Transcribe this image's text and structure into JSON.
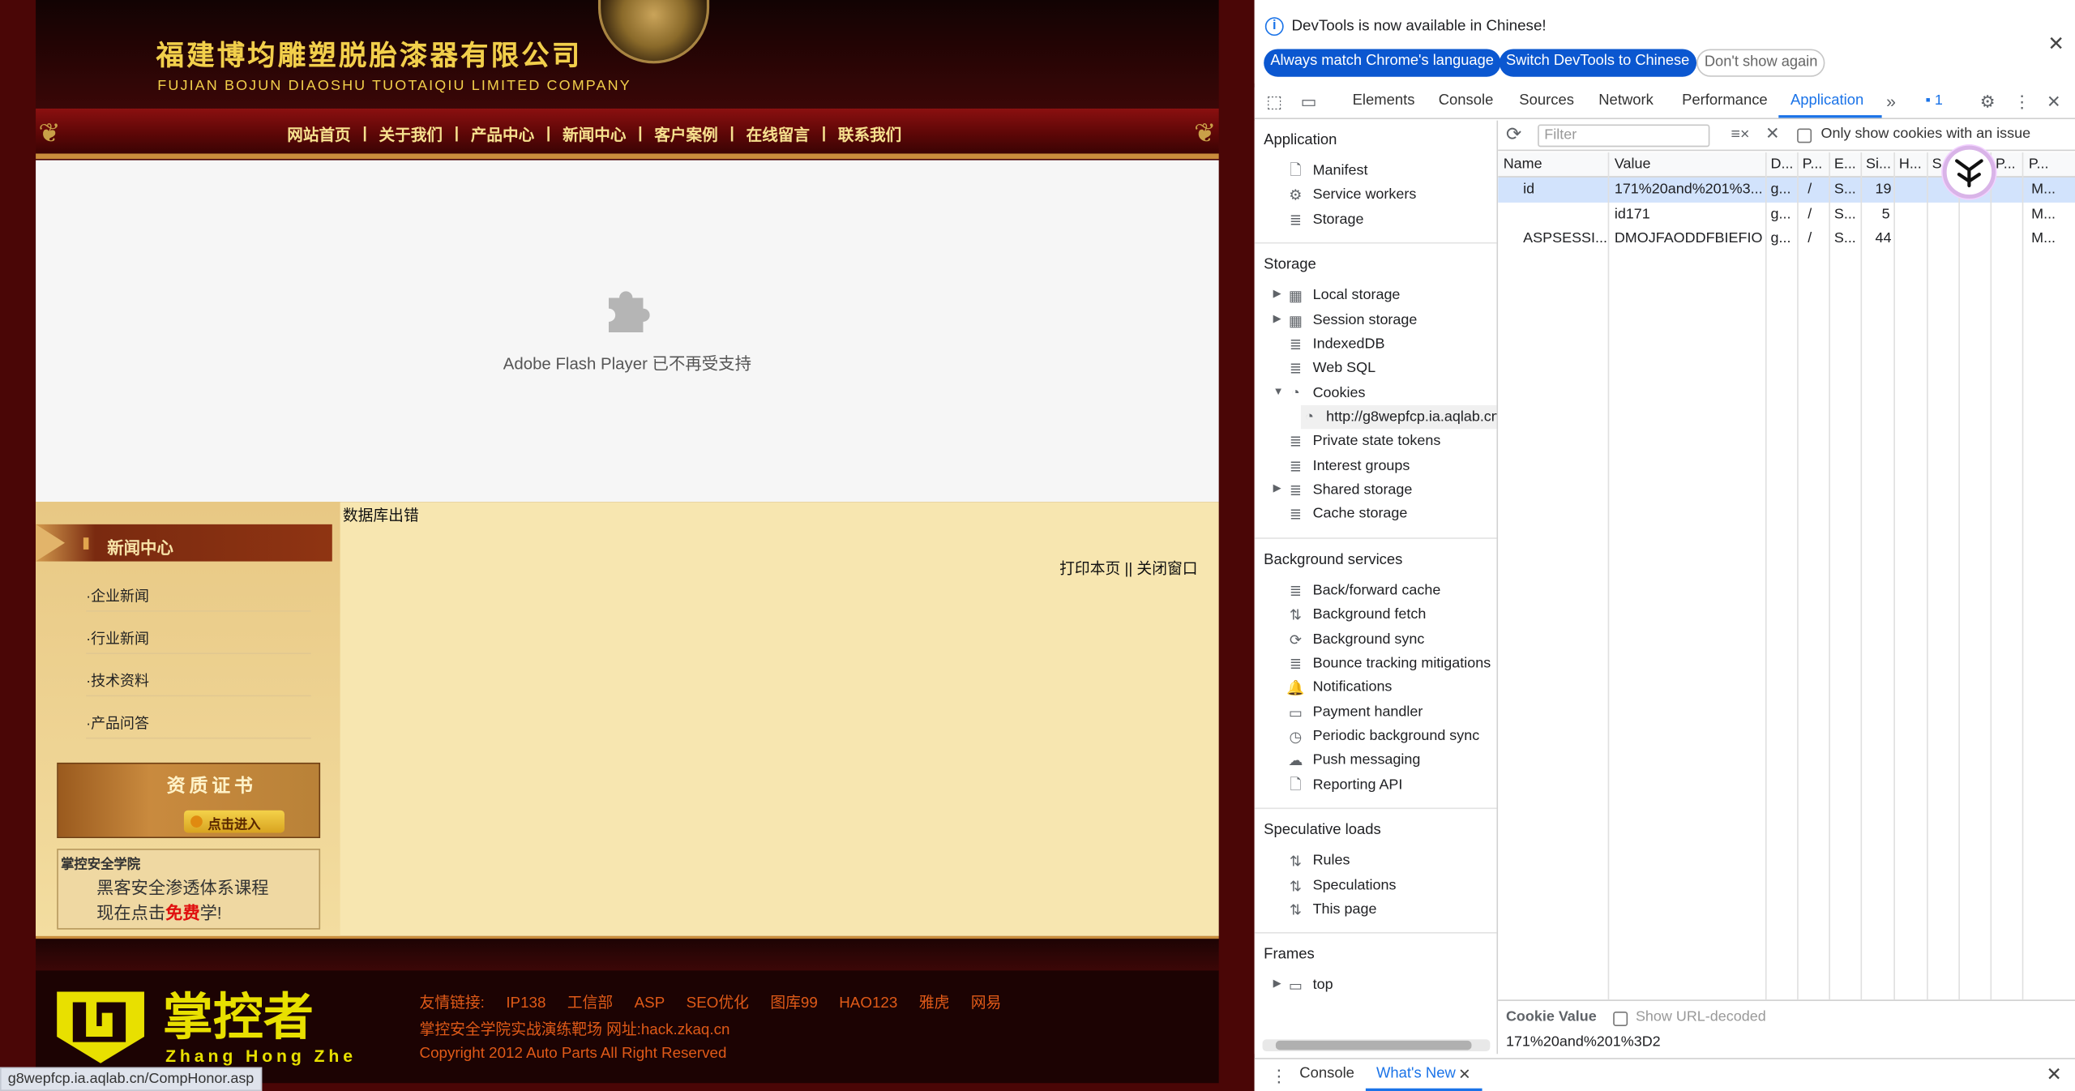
{
  "site": {
    "company_cn": "福建博均雕塑脱胎漆器有限公司",
    "company_en": "FUJIAN BOJUN DIAOSHU  TUOTAIQIU  LIMITED COMPANY",
    "nav": [
      "网站首页",
      "关于我们",
      "产品中心",
      "新闻中心",
      "客户案例",
      "在线留言",
      "联系我们"
    ],
    "nav_sep": "|",
    "flash_message": "Adobe Flash Player 已不再受支持",
    "side_title": "新闻中心",
    "side_items": [
      "·企业新闻",
      "·行业新闻",
      "·技术资料",
      "·产品问答"
    ],
    "cert_title": "资质证书",
    "cert_button": "点击进入",
    "ad_heading": "掌控安全学院",
    "ad_line1": "黑客安全渗透体系课程",
    "ad_line2_pre": "现在点击",
    "ad_line2_red": "免费",
    "ad_line2_post": "学!",
    "error_text": "数据库出错",
    "print_link": "打印本页 || 关闭窗口",
    "footer_logo_cn": "掌控者",
    "footer_logo_en": "Zhang Hong Zhe",
    "footer_links_label": "友情链接:",
    "footer_links": [
      "IP138",
      "工信部",
      "ASP",
      "SEO优化",
      "图库99",
      "HAO123",
      "雅虎",
      "网易"
    ],
    "footer_line2": "掌控安全学院实战演练靶场 网址:hack.zkaq.cn",
    "footer_line3": "Copyright 2012 Auto Parts All Right Reserved",
    "status_url": "g8wepfcp.ia.aqlab.cn/CompHonor.asp"
  },
  "devtools": {
    "banner_message": "DevTools is now available in Chinese!",
    "banner_btn1": "Always match Chrome's language",
    "banner_btn2": "Switch DevTools to Chinese",
    "banner_btn3": "Don't show again",
    "tabs": [
      "Elements",
      "Console",
      "Sources",
      "Network",
      "Performance",
      "Application"
    ],
    "active_tab": "Application",
    "issues_count": "1",
    "sections": {
      "application": {
        "title": "Application",
        "items": [
          "Manifest",
          "Service workers",
          "Storage"
        ]
      },
      "storage": {
        "title": "Storage",
        "items": [
          "Local storage",
          "Session storage",
          "IndexedDB",
          "Web SQL",
          "Cookies",
          "http://g8wepfcp.ia.aqlab.cn",
          "Private state tokens",
          "Interest groups",
          "Shared storage",
          "Cache storage"
        ]
      },
      "background": {
        "title": "Background services",
        "items": [
          "Back/forward cache",
          "Background fetch",
          "Background sync",
          "Bounce tracking mitigations",
          "Notifications",
          "Payment handler",
          "Periodic background sync",
          "Push messaging",
          "Reporting API"
        ]
      },
      "speculative": {
        "title": "Speculative loads",
        "items": [
          "Rules",
          "Speculations",
          "This page"
        ]
      },
      "frames": {
        "title": "Frames",
        "items": [
          "top"
        ]
      }
    },
    "filter_placeholder": "Filter",
    "only_issue_label": "Only show cookies with an issue",
    "columns": [
      "Name",
      "Value",
      "D...",
      "P...",
      "E...",
      "Si...",
      "H...",
      "S",
      "S",
      "P...",
      "P..."
    ],
    "rows": [
      {
        "name": "id",
        "value": "171%20and%201%3...",
        "domain": "g...",
        "path": "/",
        "expires": "S...",
        "size": "19",
        "last": "M..."
      },
      {
        "name": "",
        "value": "id171",
        "domain": "g...",
        "path": "/",
        "expires": "S...",
        "size": "5",
        "last": "M..."
      },
      {
        "name": "ASPSESSI...",
        "value": "DMOJFAODDFBIEFIO...",
        "domain": "g...",
        "path": "/",
        "expires": "S...",
        "size": "44",
        "last": "M..."
      }
    ],
    "cookie_value_label": "Cookie Value",
    "show_decoded_label": "Show URL-decoded",
    "cookie_value": "171%20and%201%3D2",
    "drawer_tabs": [
      "Console",
      "What's New"
    ],
    "drawer_active": "What's New"
  }
}
